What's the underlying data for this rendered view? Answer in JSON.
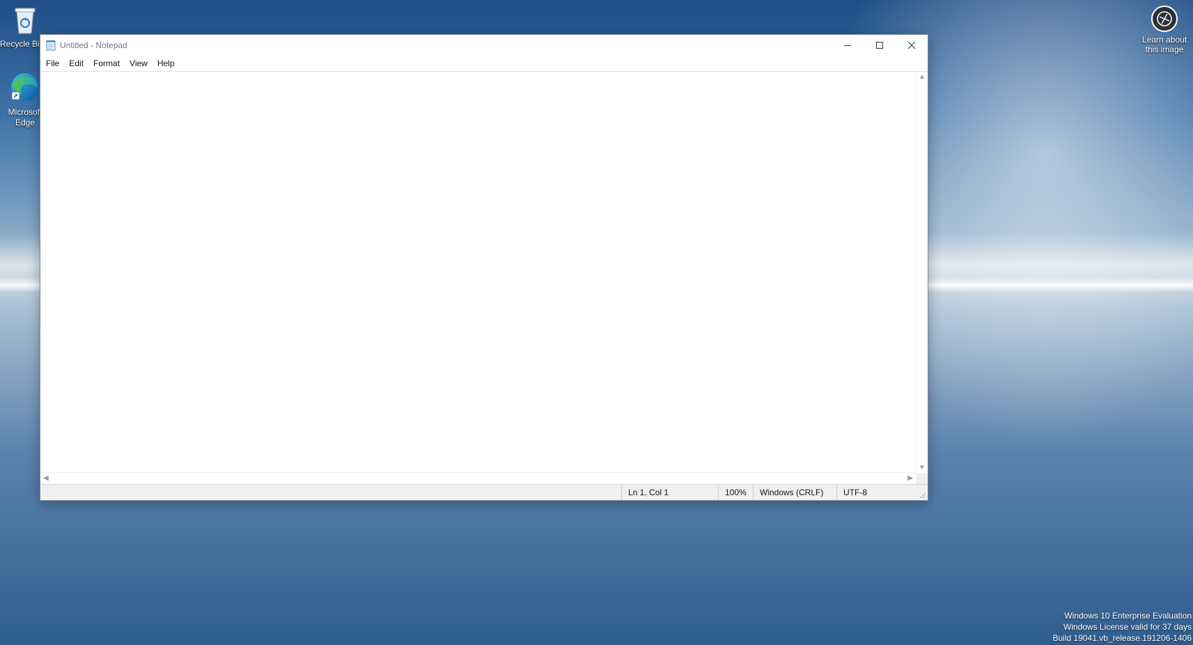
{
  "desktop": {
    "icons": [
      {
        "label": "Recycle Bin",
        "icon": "recycle-bin-icon"
      },
      {
        "label": "Microsoft Edge",
        "icon": "edge-icon"
      }
    ],
    "learn_about": {
      "line1": "Learn about",
      "line2": "this image",
      "icon": "camera-icon"
    },
    "watermark": {
      "line1": "Windows 10 Enterprise Evaluation",
      "line2": "Windows License valid for 37 days",
      "line3": "Build 19041.vb_release.191206-1406"
    }
  },
  "window": {
    "title": "Untitled - Notepad",
    "app_icon": "notepad-icon",
    "controls": [
      "minimize-icon",
      "maximize-icon",
      "close-icon"
    ],
    "menu": [
      "File",
      "Edit",
      "Format",
      "View",
      "Help"
    ],
    "content": "",
    "status": {
      "position": "Ln 1, Col 1",
      "zoom": "100%",
      "line_ending": "Windows (CRLF)",
      "encoding": "UTF-8"
    }
  }
}
